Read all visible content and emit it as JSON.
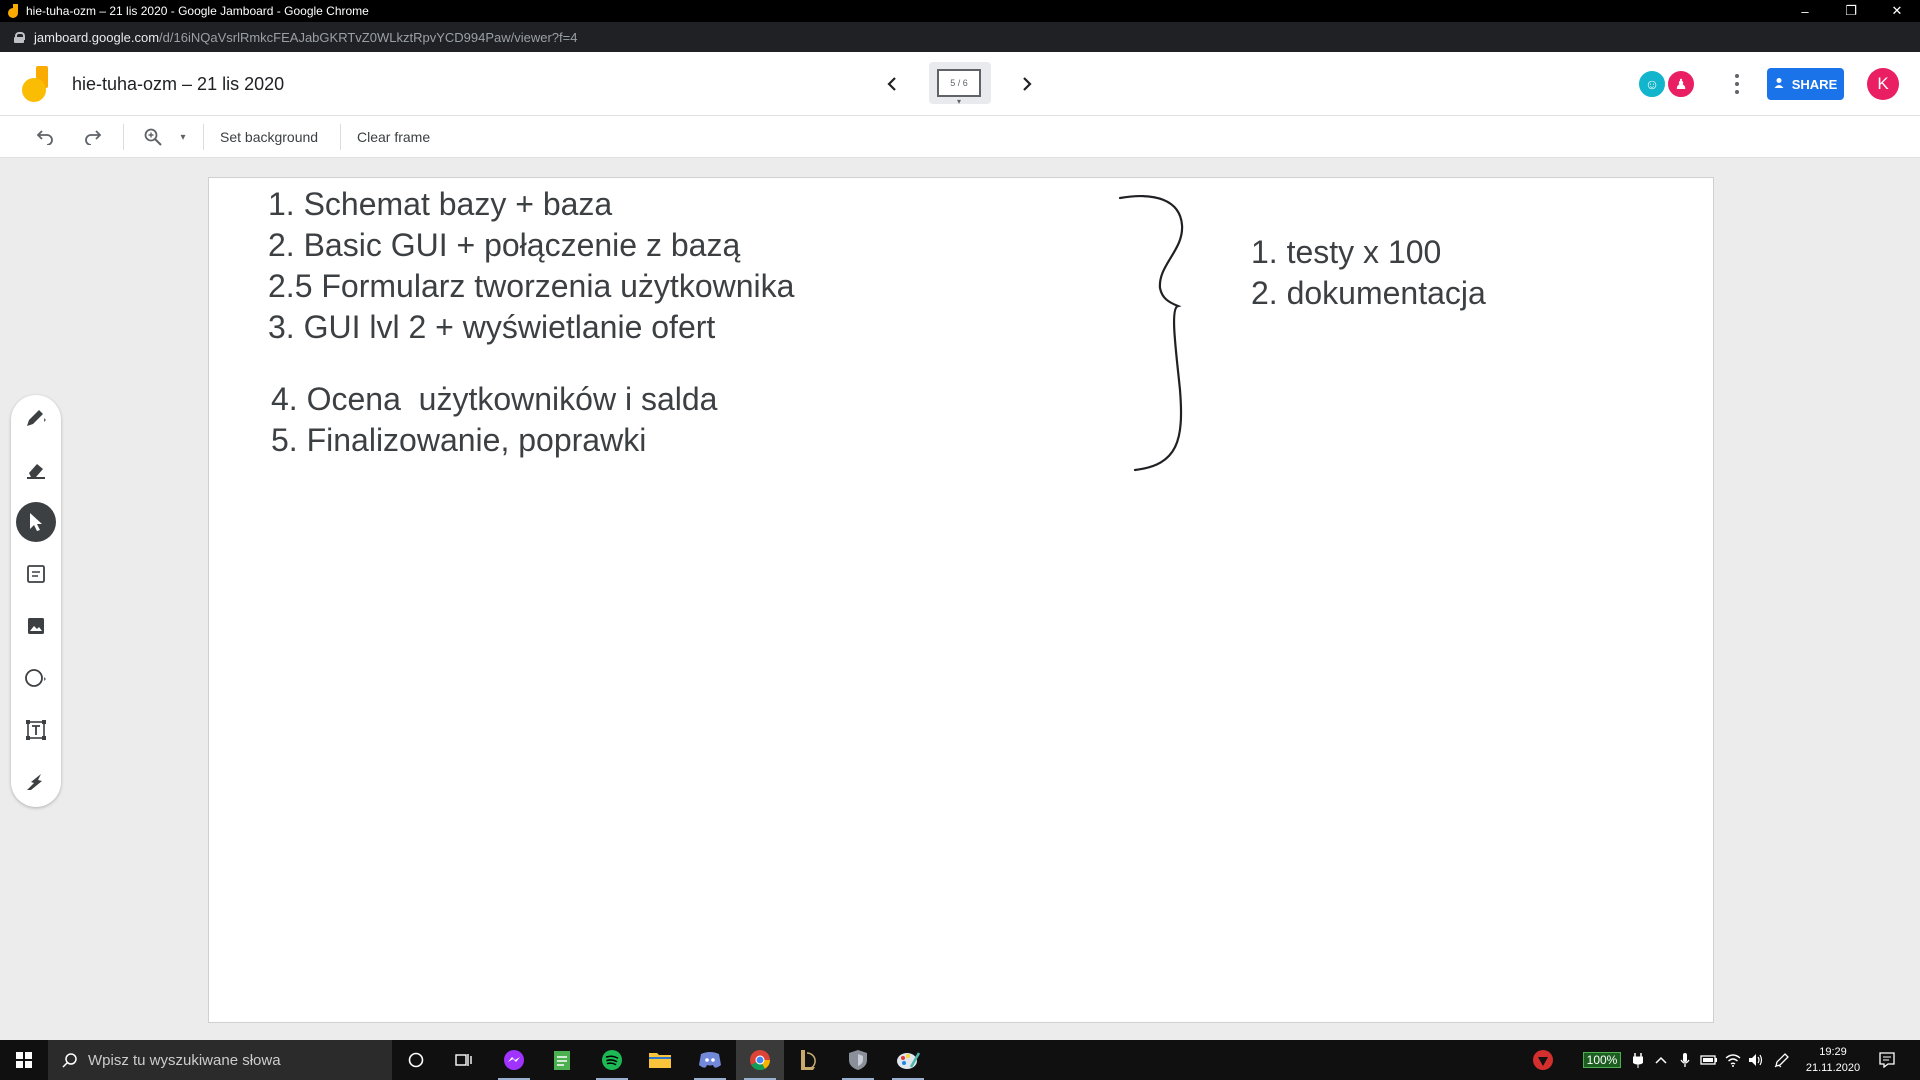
{
  "browser": {
    "window_title": "hie-tuha-ozm – 21 lis 2020 - Google Jamboard - Google Chrome",
    "url_host": "jamboard.google.com",
    "url_path": "/d/16iNQaVsrlRmkcFEAJabGKRTvZ0WLkztRpvYCD994Paw/viewer?f=4",
    "window_controls": {
      "minimize": "–",
      "restore": "❐",
      "close": "✕"
    }
  },
  "header": {
    "doc_title": "hie-tuha-ozm – 21 lis 2020",
    "frame_indicator": "5 / 6",
    "share_label": "SHARE",
    "avatar_initial": "K",
    "collaborators": [
      {
        "name": "collaborator-1",
        "color": "#12b5cb",
        "glyph": "☺"
      },
      {
        "name": "collaborator-2",
        "color": "#e91e63",
        "glyph": "♟"
      }
    ]
  },
  "toolbar": {
    "set_background": "Set background",
    "clear_frame": "Clear frame"
  },
  "board": {
    "left_list": [
      "1. Schemat bazy + baza",
      "2. Basic GUI + połączenie z bazą",
      "2.5 Formularz tworzenia użytkownika",
      "3. GUI lvl 2 + wyświetlanie ofert"
    ],
    "left_list_2": [
      "4. Ocena  użytkowników i salda",
      "5. Finalizowanie, poprawki"
    ],
    "right_list": [
      "1. testy x 100",
      "2. dokumentacja"
    ]
  },
  "palette": {
    "tools": [
      "pen",
      "eraser",
      "select",
      "sticky-note",
      "image",
      "circle",
      "text-box",
      "laser"
    ],
    "active": "select"
  },
  "taskbar": {
    "search_placeholder": "Wpisz tu wyszukiwane słowa",
    "battery": "100%",
    "time": "19:29",
    "date": "21.11.2020"
  },
  "colors": {
    "accent": "#1a73e8",
    "avatar": "#e91e63",
    "text": "#3c4043",
    "logo": "#fbbc04"
  }
}
